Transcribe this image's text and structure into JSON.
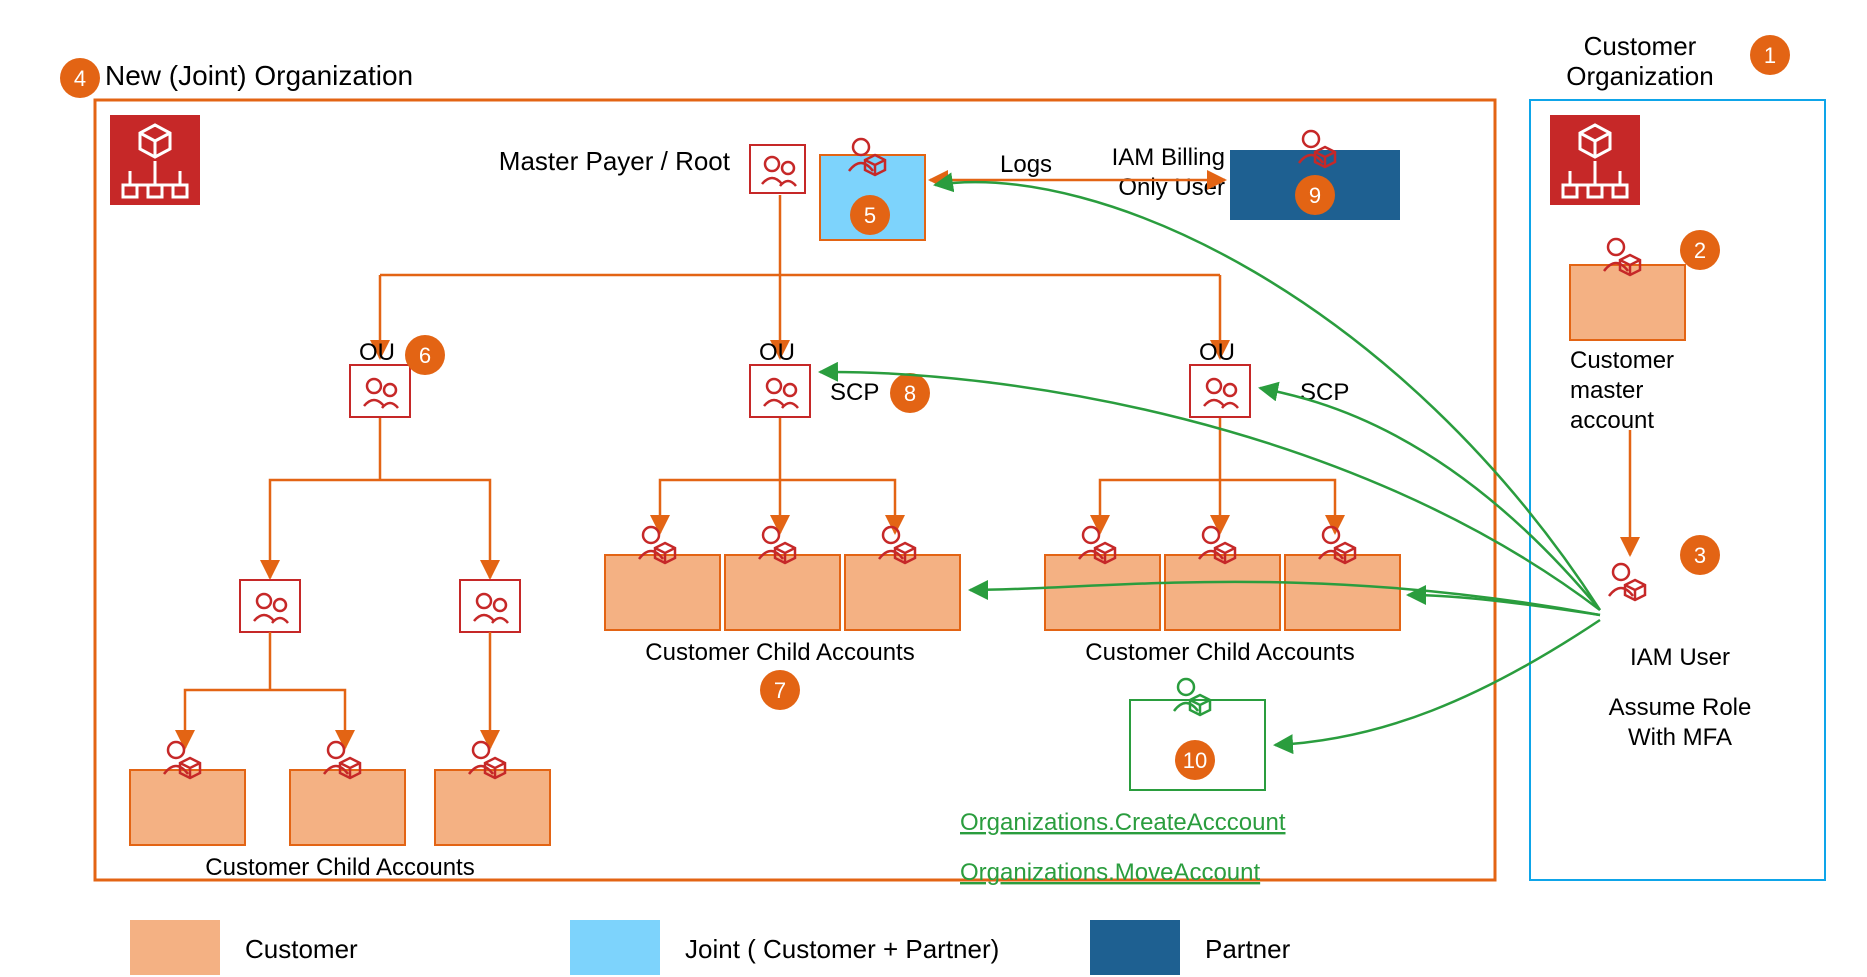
{
  "titles": {
    "customer_org_line1": "Customer",
    "customer_org_line2": "Organization",
    "new_joint_org": "New (Joint) Organization",
    "master_payer": "Master Payer / Root",
    "iam_billing_line1": "IAM Billing",
    "iam_billing_line2": "Only User",
    "customer_master_line1": "Customer",
    "customer_master_line2": "master",
    "customer_master_line3": "account",
    "iam_user": "IAM User",
    "assume_role_line1": "Assume Role",
    "assume_role_line2": "With MFA"
  },
  "labels": {
    "ou": "OU",
    "scp": "SCP",
    "logs": "Logs",
    "customer_child_accounts": "Customer Child  Accounts",
    "org_create": "Organizations.CreateAcccount",
    "org_move": "Organizations.MoveAccount"
  },
  "legend": {
    "customer": "Customer",
    "joint": "Joint ( Customer + Partner)",
    "partner": "Partner"
  },
  "colors": {
    "orange": "#e36414",
    "orange_fill": "#f4b183",
    "red": "#c62828",
    "dark_red": "#b71c1c",
    "sky": "#7dd3fc",
    "blue": "#1e6091",
    "green": "#2a9d3e",
    "marker_fill": "#e36414",
    "marker_text": "#ffffff",
    "cust_border": "#0ea5e9"
  },
  "markers": {
    "m1": "1",
    "m2": "2",
    "m3": "3",
    "m4": "4",
    "m5": "5",
    "m6": "6",
    "m7": "7",
    "m8": "8",
    "m9": "9",
    "m10": "10"
  },
  "chart_data": {
    "type": "diagram",
    "title": "AWS multi-account organization with customer joint management",
    "legend": [
      {
        "color": "#f4b183",
        "label": "Customer"
      },
      {
        "color": "#7dd3fc",
        "label": "Joint ( Customer + Partner)"
      },
      {
        "color": "#1e6091",
        "label": "Partner"
      }
    ],
    "nodes": [
      {
        "id": "cust_org",
        "label": "Customer Organization",
        "marker": 1,
        "type": "org-box",
        "owner": "customer"
      },
      {
        "id": "cust_master",
        "label": "Customer master account",
        "marker": 2,
        "type": "account",
        "owner": "customer"
      },
      {
        "id": "iam_user",
        "label": "IAM User / Assume Role With MFA",
        "marker": 3,
        "type": "iam-user",
        "owner": "customer"
      },
      {
        "id": "joint_org",
        "label": "New (Joint) Organization",
        "marker": 4,
        "type": "org-box",
        "owner": "joint"
      },
      {
        "id": "master_payer",
        "label": "Master Payer / Root",
        "marker": 5,
        "type": "account",
        "owner": "joint"
      },
      {
        "id": "ou_left",
        "label": "OU",
        "marker": 6,
        "type": "ou"
      },
      {
        "id": "ou_mid",
        "label": "OU",
        "type": "ou"
      },
      {
        "id": "ou_right",
        "label": "OU",
        "type": "ou"
      },
      {
        "id": "ou_left_child1",
        "label": "",
        "type": "ou"
      },
      {
        "id": "ou_left_child2",
        "label": "",
        "type": "ou"
      },
      {
        "id": "cust_children_mid",
        "label": "Customer Child Accounts",
        "marker": 7,
        "type": "account-group",
        "owner": "customer",
        "count": 3
      },
      {
        "id": "cust_children_right",
        "label": "Customer Child Accounts",
        "type": "account-group",
        "owner": "customer",
        "count": 3
      },
      {
        "id": "cust_children_left",
        "label": "Customer Child Accounts",
        "type": "account-group",
        "owner": "customer",
        "count": 3
      },
      {
        "id": "scp",
        "label": "SCP",
        "marker": 8,
        "type": "policy"
      },
      {
        "id": "iam_billing",
        "label": "IAM Billing Only User",
        "marker": 9,
        "type": "iam-user",
        "owner": "partner"
      },
      {
        "id": "create_acct_role",
        "label": "Organizations.CreateAcccount / Organizations.MoveAccount",
        "marker": 10,
        "type": "iam-role"
      }
    ],
    "edges": [
      {
        "from": "master_payer",
        "to": "ou_left",
        "style": "orange-arrow"
      },
      {
        "from": "master_payer",
        "to": "ou_mid",
        "style": "orange-arrow"
      },
      {
        "from": "master_payer",
        "to": "ou_right",
        "style": "orange-arrow"
      },
      {
        "from": "ou_left",
        "to": "ou_left_child1",
        "style": "orange-arrow"
      },
      {
        "from": "ou_left",
        "to": "ou_left_child2",
        "style": "orange-arrow"
      },
      {
        "from": "ou_left_child1",
        "to": "cust_children_left",
        "style": "orange-arrow"
      },
      {
        "from": "ou_left_child2",
        "to": "cust_children_left",
        "style": "orange-arrow"
      },
      {
        "from": "ou_mid",
        "to": "cust_children_mid",
        "style": "orange-arrow"
      },
      {
        "from": "ou_right",
        "to": "cust_children_right",
        "style": "orange-arrow"
      },
      {
        "from": "cust_master",
        "to": "iam_user",
        "style": "orange-arrow"
      },
      {
        "from": "master_payer",
        "to": "iam_billing",
        "label": "Logs",
        "style": "orange-double-arrow"
      },
      {
        "from": "iam_user",
        "to": "master_payer",
        "style": "green-arrow"
      },
      {
        "from": "iam_user",
        "to": "ou_mid",
        "label": "SCP",
        "style": "green-arrow"
      },
      {
        "from": "iam_user",
        "to": "ou_right",
        "label": "SCP",
        "style": "green-arrow"
      },
      {
        "from": "iam_user",
        "to": "cust_children_mid",
        "style": "green-arrow"
      },
      {
        "from": "iam_user",
        "to": "cust_children_right",
        "style": "green-arrow"
      },
      {
        "from": "iam_user",
        "to": "create_acct_role",
        "style": "green-arrow"
      }
    ]
  }
}
